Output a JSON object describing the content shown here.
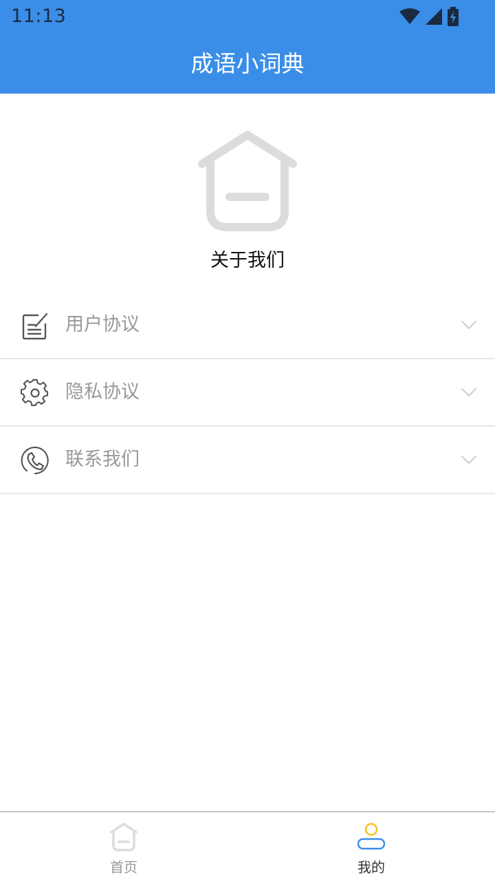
{
  "status_bar": {
    "time": "11:13",
    "icons": [
      "wifi-icon",
      "signal-icon",
      "battery-charging-icon"
    ]
  },
  "header": {
    "title": "成语小词典"
  },
  "about": {
    "label": "关于我们",
    "icon": "home-icon"
  },
  "menu": {
    "items": [
      {
        "label": "用户协议",
        "icon": "document-edit-icon"
      },
      {
        "label": "隐私协议",
        "icon": "gear-icon"
      },
      {
        "label": "联系我们",
        "icon": "phone-icon"
      }
    ]
  },
  "tabbar": {
    "tabs": [
      {
        "label": "首页",
        "icon": "home-icon",
        "active": false
      },
      {
        "label": "我的",
        "icon": "user-icon",
        "active": true
      }
    ]
  },
  "colors": {
    "header_bg": "#3a8ee8",
    "menu_text": "#999999",
    "divider": "#e6e6e6",
    "active_tab_icon_head": "#f5c11e",
    "active_tab_icon_body": "#3a8ee8"
  }
}
